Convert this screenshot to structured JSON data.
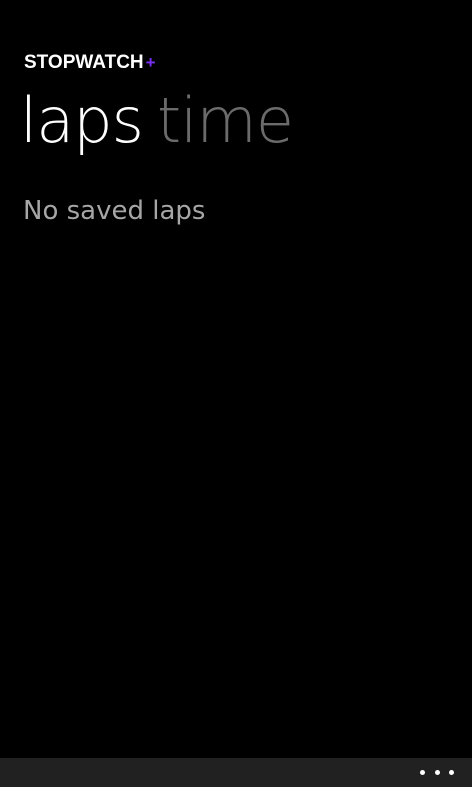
{
  "app": {
    "title": "STOPWATCH",
    "title_suffix": "+",
    "accent_color": "#7b2ff7"
  },
  "pivot": {
    "items": [
      {
        "label": "laps",
        "active": true
      },
      {
        "label": "time",
        "active": false
      }
    ]
  },
  "laps": {
    "empty_message": "No saved laps"
  },
  "app_bar": {
    "more_icon": "ellipsis-icon"
  }
}
